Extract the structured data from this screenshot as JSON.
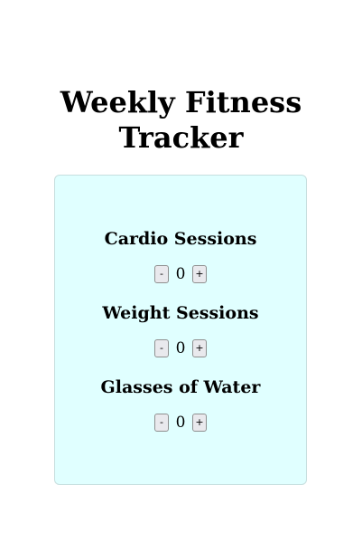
{
  "page": {
    "title": "Weekly Fitness Tracker"
  },
  "trackers": [
    {
      "label": "Cardio Sessions",
      "value": "0",
      "decrement_label": "-",
      "increment_label": "+"
    },
    {
      "label": "Weight Sessions",
      "value": "0",
      "decrement_label": "-",
      "increment_label": "+"
    },
    {
      "label": "Glasses of Water",
      "value": "0",
      "decrement_label": "-",
      "increment_label": "+"
    }
  ],
  "colors": {
    "card_background": "#e0ffff",
    "card_border": "#c6dede",
    "button_background": "#e9e9ed"
  }
}
